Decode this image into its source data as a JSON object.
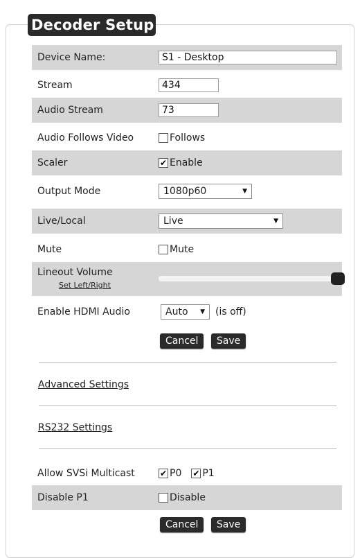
{
  "title": "Decoder Setup",
  "fields": {
    "device_name": {
      "label": "Device Name:",
      "value": "S1 - Desktop"
    },
    "stream": {
      "label": "Stream",
      "value": "434"
    },
    "audio_stream": {
      "label": "Audio Stream",
      "value": "73"
    },
    "audio_follows_video": {
      "label": "Audio Follows Video",
      "checkbox_label": "Follows",
      "checked": false
    },
    "scaler": {
      "label": "Scaler",
      "checkbox_label": "Enable",
      "checked": true
    },
    "output_mode": {
      "label": "Output Mode",
      "selected": "1080p60"
    },
    "live_local": {
      "label": "Live/Local",
      "selected": "Live"
    },
    "mute": {
      "label": "Mute",
      "checkbox_label": "Mute",
      "checked": false
    },
    "lineout_volume": {
      "label": "Lineout Volume",
      "sublink": "Set Left/Right",
      "value_fraction": 1.0
    },
    "enable_hdmi_audio": {
      "label": "Enable HDMI Audio",
      "selected": "Auto",
      "status": "(is off)"
    }
  },
  "buttons": {
    "cancel": "Cancel",
    "save": "Save"
  },
  "links": {
    "advanced": "Advanced Settings",
    "rs232": "RS232 Settings"
  },
  "multicast": {
    "label": "Allow SVSi Multicast",
    "p0_label": "P0",
    "p0_checked": true,
    "p1_label": "P1",
    "p1_checked": true
  },
  "disable_p1": {
    "label": "Disable P1",
    "checkbox_label": "Disable",
    "checked": false
  },
  "colors": {
    "shade": "#d6d6d6",
    "button_bg": "#2b2b2b",
    "title_bg": "#2a2a2a"
  }
}
